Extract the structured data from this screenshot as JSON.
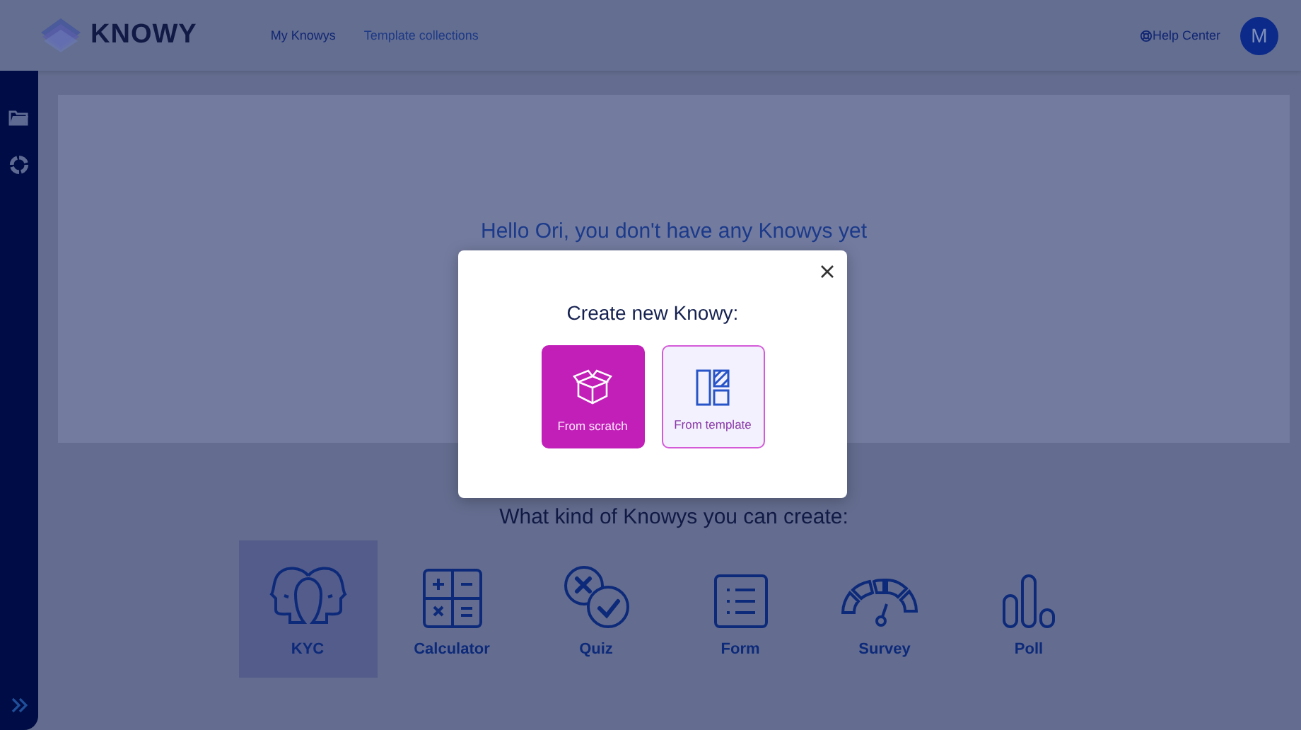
{
  "header": {
    "logo": "KNOWY",
    "nav": [
      {
        "label": "My Knowys",
        "selected": true
      },
      {
        "label": "Template collections",
        "selected": false
      }
    ],
    "help": "Help Center",
    "avatar": "M"
  },
  "sidebar": {
    "items": [
      {
        "kind": "folder"
      },
      {
        "kind": "chart"
      }
    ]
  },
  "main": {
    "greeting": "Hello Ori, you don't have any Knowys yet",
    "types_heading": "What kind of Knowys you can create:",
    "types": [
      {
        "kind": "kyc",
        "label": "KYC",
        "selected": true
      },
      {
        "kind": "calculator",
        "label": "Calculator",
        "selected": false
      },
      {
        "kind": "quiz",
        "label": "Quiz",
        "selected": false
      },
      {
        "kind": "form",
        "label": "Form",
        "selected": false
      },
      {
        "kind": "survey",
        "label": "Survey",
        "selected": false
      },
      {
        "kind": "poll",
        "label": "Poll",
        "selected": false
      }
    ]
  },
  "modal": {
    "title": "Create new Knowy:",
    "options": [
      {
        "kind": "scratch",
        "label": "From scratch",
        "selected": true
      },
      {
        "kind": "template",
        "label": "From template",
        "selected": false
      }
    ]
  }
}
